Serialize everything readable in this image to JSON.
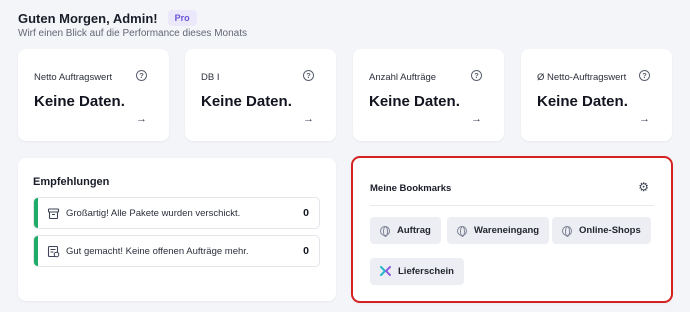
{
  "header": {
    "greeting": "Guten Morgen, Admin!",
    "badge": "Pro",
    "subtitle": "Wirf einen Blick auf die Performance dieses Monats"
  },
  "kpis": [
    {
      "label": "Netto Auftragswert",
      "value": "Keine Daten.",
      "help": "?",
      "arrow": "→"
    },
    {
      "label": "DB I",
      "value": "Keine Daten.",
      "help": "?",
      "arrow": "→"
    },
    {
      "label": "Anzahl Aufträge",
      "value": "Keine Daten.",
      "help": "?",
      "arrow": "→"
    },
    {
      "label": "Ø Netto-Auftragswert",
      "value": "Keine Daten.",
      "help": "?",
      "arrow": "→"
    }
  ],
  "recommendations": {
    "title": "Empfehlungen",
    "items": [
      {
        "text": "Großartig! Alle Pakete wurden verschickt.",
        "count": "0",
        "icon": "package-icon"
      },
      {
        "text": "Gut gemacht! Keine offenen Aufträge mehr.",
        "count": "0",
        "icon": "order-icon"
      }
    ],
    "accent_color": "#1fab68"
  },
  "bookmarks": {
    "title": "Meine Bookmarks",
    "gear": "⚙",
    "items": [
      {
        "label": "Auftrag",
        "icon": "globe-icon"
      },
      {
        "label": "Wareneingang",
        "icon": "globe-icon"
      },
      {
        "label": "Online-Shops",
        "icon": "globe-icon"
      },
      {
        "label": "Lieferschein",
        "icon": "app-logo-icon"
      }
    ],
    "highlight_color": "#d3221f"
  }
}
